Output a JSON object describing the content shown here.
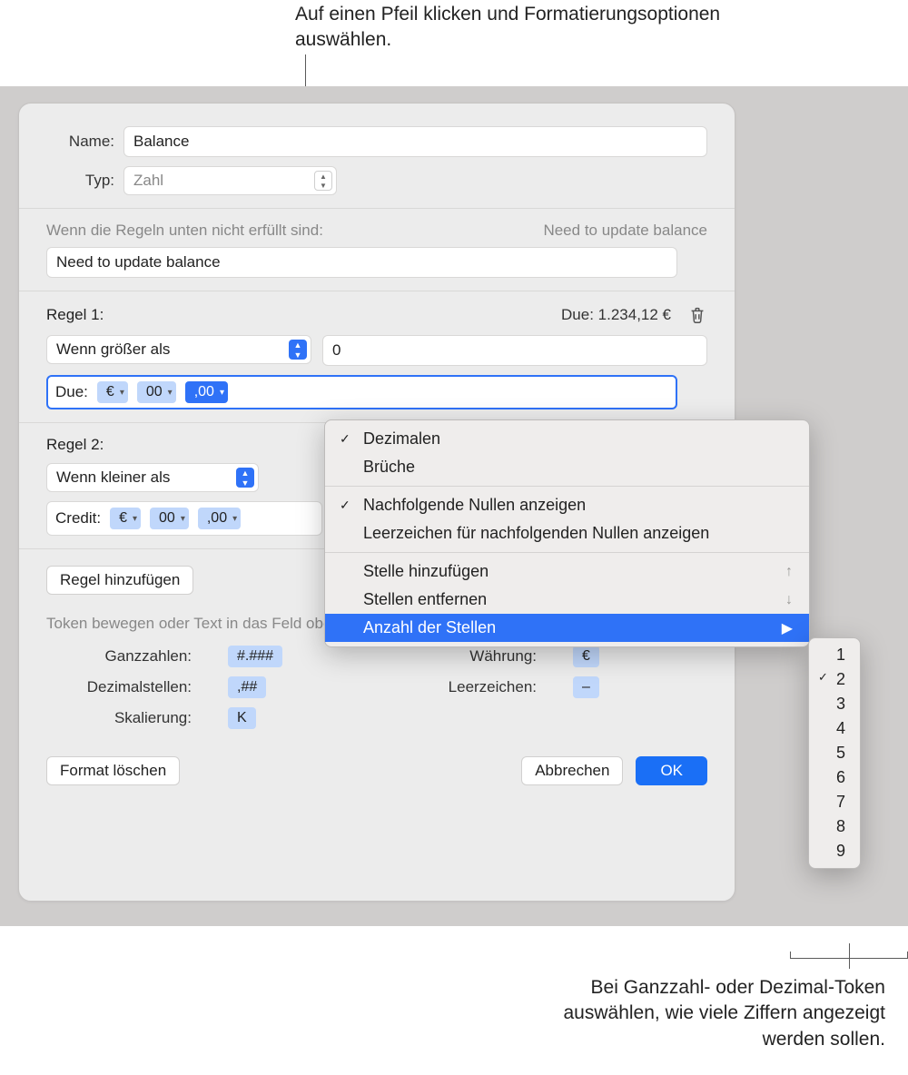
{
  "annotations": {
    "top": "Auf einen Pfeil klicken und Formatierungsoptionen auswählen.",
    "bottom": "Bei Ganzzahl- oder Dezimal-Token auswählen, wie viele Ziffern angezeigt werden sollen."
  },
  "fields": {
    "name_label": "Name:",
    "name_value": "Balance",
    "type_label": "Typ:",
    "type_value": "Zahl",
    "cond_label": "Wenn die Regeln unten nicht erfüllt sind:",
    "cond_preview": "Need to update balance",
    "cond_value": "Need to update balance"
  },
  "rules": [
    {
      "title": "Regel 1:",
      "preview": "Due: 1.234,12 €",
      "op": "Wenn größer als",
      "value": "0",
      "token_label": "Due:",
      "tokens": [
        "€",
        "00",
        ",00"
      ],
      "focused": true
    },
    {
      "title": "Regel 2:",
      "op": "Wenn kleiner als",
      "token_label": "Credit:",
      "tokens": [
        "€",
        "00",
        ",00"
      ],
      "focused": false
    }
  ],
  "buttons": {
    "add_rule": "Regel hinzufügen",
    "delete_format": "Format löschen",
    "cancel": "Abbrechen",
    "ok": "OK"
  },
  "token_section": {
    "hint": "Token bewegen oder Text in das Feld oben eingeben:",
    "integers_label": "Ganzzahlen:",
    "integers_token": "#.###",
    "decimals_label": "Dezimalstellen:",
    "decimals_token": ",##",
    "scale_label": "Skalierung:",
    "scale_token": "K",
    "currency_label": "Währung:",
    "currency_token": "€",
    "space_label": "Leerzeichen:",
    "space_token": "–"
  },
  "menu": {
    "decimals": "Dezimalen",
    "fractions": "Brüche",
    "trailing_zeros": "Nachfolgende Nullen anzeigen",
    "spaces_trailing": "Leerzeichen für nachfolgenden Nullen anzeigen",
    "add_digit": "Stelle hinzufügen",
    "remove_digit": "Stellen entfernen",
    "num_digits": "Anzahl der Stellen"
  },
  "submenu": {
    "selected": 2,
    "items": [
      "1",
      "2",
      "3",
      "4",
      "5",
      "6",
      "7",
      "8",
      "9"
    ]
  }
}
